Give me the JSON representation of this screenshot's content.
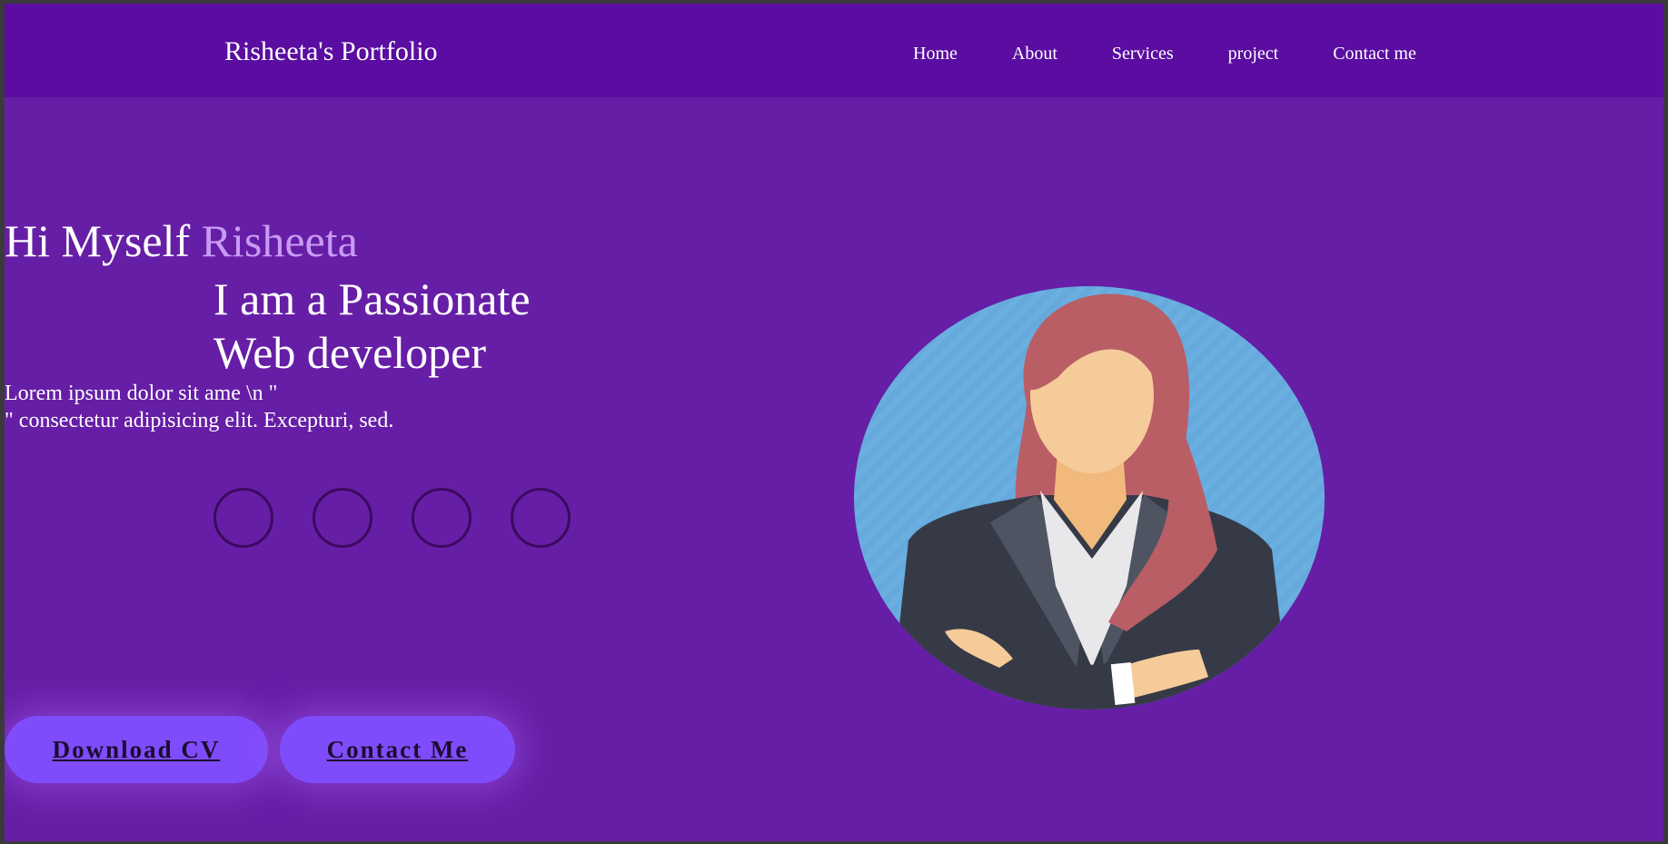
{
  "header": {
    "brand": "Risheeta's Portfolio",
    "nav": [
      "Home",
      "About",
      "Services",
      "project",
      "Contact me"
    ]
  },
  "hero": {
    "greeting": "Hi Myself",
    "name": "Risheeta",
    "tagline_1": "I am a Passionate",
    "tagline_2": "Web developer",
    "description_1": "Lorem ipsum dolor sit ame \\n \"",
    "description_2": "\" consectetur adipisicing elit. Excepturi, sed."
  },
  "buttons": {
    "download_cv": "Download CV",
    "contact_me": "Contact Me"
  },
  "colors": {
    "background": "#661ea6",
    "navbar": "#5a0da0",
    "accent_name": "#c89af5",
    "button": "#7f4cfb",
    "avatar_circle": "#6aafe0"
  },
  "icons": [
    "social-icon-1",
    "social-icon-2",
    "social-icon-3",
    "social-icon-4"
  ]
}
